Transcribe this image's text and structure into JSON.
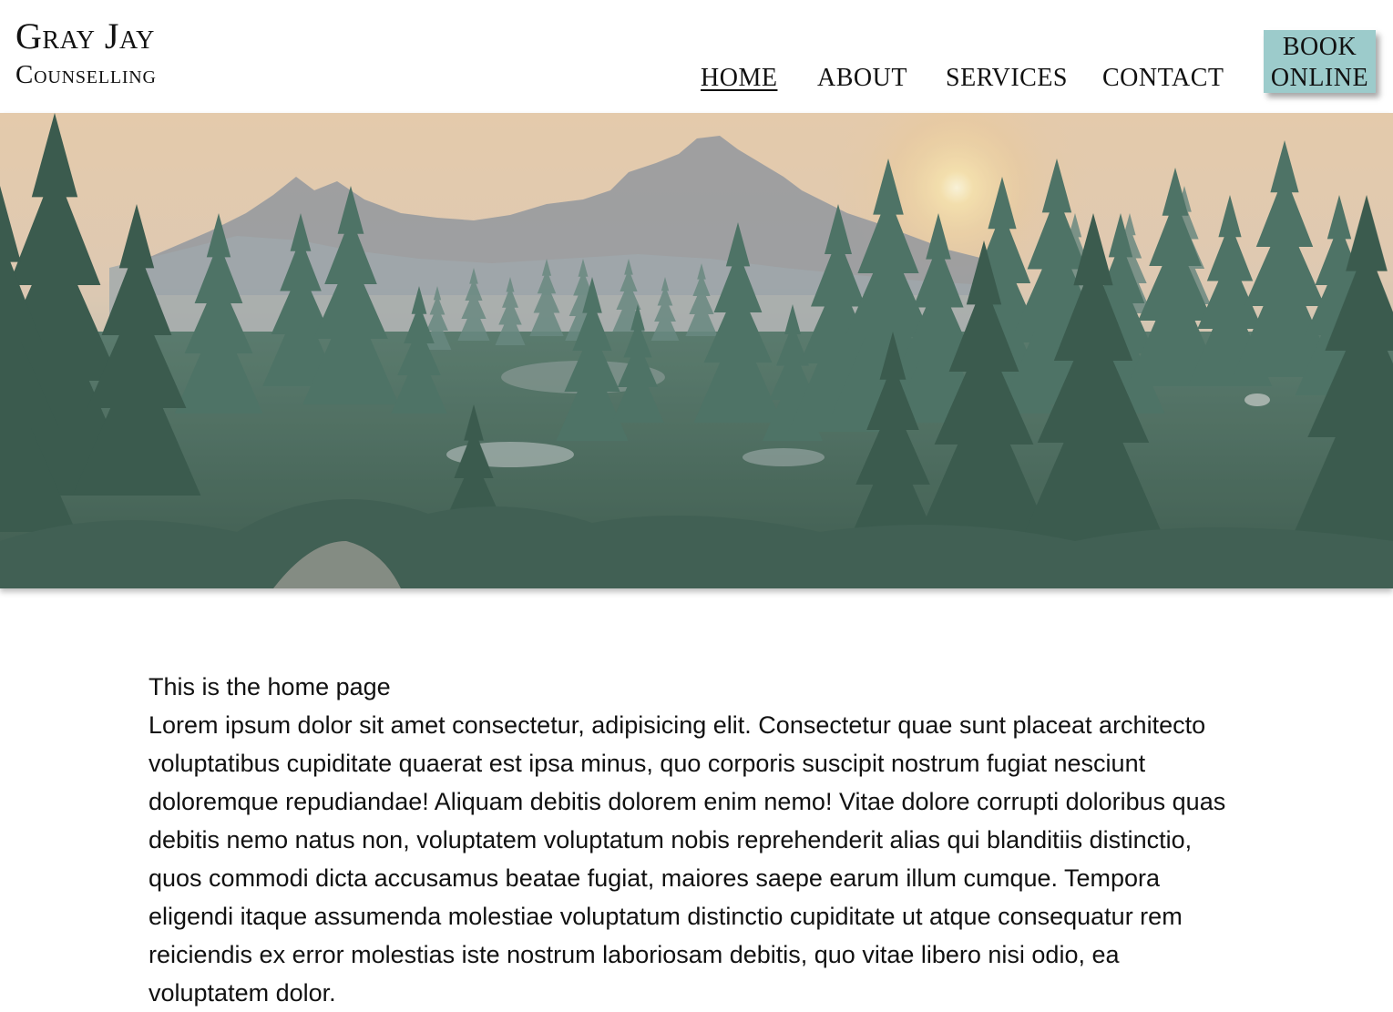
{
  "brand": {
    "name_line1": "Gray Jay",
    "name_line2": "Counselling"
  },
  "nav": {
    "items": [
      {
        "label": "HOME",
        "active": true
      },
      {
        "label": "ABOUT",
        "active": false
      },
      {
        "label": "SERVICES",
        "active": false
      },
      {
        "label": "CONTACT",
        "active": false
      }
    ]
  },
  "cta": {
    "line1": "BOOK",
    "line2": "ONLINE",
    "color": "#9ccbcb"
  },
  "hero": {
    "image": "forest-mountain-sunset-landscape"
  },
  "main": {
    "heading": "This is the home page",
    "body": "Lorem ipsum dolor sit amet consectetur, adipisicing elit. Consectetur quae sunt placeat architecto voluptatibus cupiditate quaerat est ipsa minus, quo corporis suscipit nostrum fugiat nesciunt doloremque repudiandae! Aliquam debitis dolorem enim nemo! Vitae dolore corrupti doloribus quas debitis nemo natus non, voluptatem voluptatum nobis reprehenderit alias qui blanditiis distinctio, quos commodi dicta accusamus beatae fugiat, maiores saepe earum illum cumque. Tempora eligendi itaque assumenda molestiae voluptatum distinctio cupiditate ut atque consequatur rem reiciendis ex error molestias iste nostrum laboriosam debitis, quo vitae libero nisi odio, ea voluptatem dolor."
  }
}
